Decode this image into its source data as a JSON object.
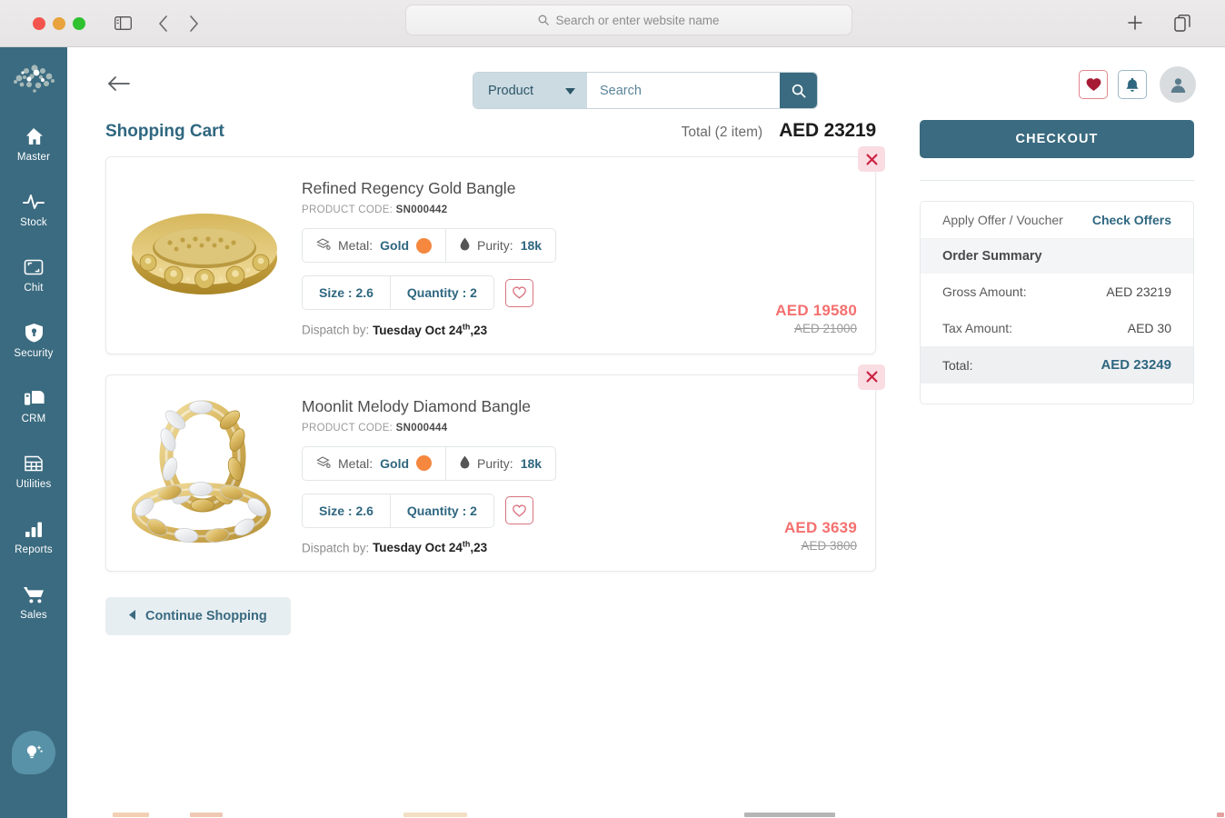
{
  "browser": {
    "url_placeholder": "Search or enter website name",
    "icons": {
      "sidebar_toggle": "sidebar-toggle-icon",
      "back": "back-chevron-icon",
      "forward": "forward-chevron-icon",
      "new_tab": "plus-icon",
      "tab_overview": "tab-overview-icon",
      "search": "search-icon"
    }
  },
  "sidebar": {
    "logo": "bubble-cloud-logo",
    "items": [
      {
        "label": "Master",
        "icon": "home-icon"
      },
      {
        "label": "Stock",
        "icon": "pulse-icon"
      },
      {
        "label": "Chit",
        "icon": "chit-frame-icon"
      },
      {
        "label": "Security",
        "icon": "shield-icon"
      },
      {
        "label": "CRM",
        "icon": "crm-cards-icon"
      },
      {
        "label": "Utilities",
        "icon": "table-grid-icon"
      },
      {
        "label": "Reports",
        "icon": "bar-chart-icon"
      },
      {
        "label": "Sales",
        "icon": "cart-icon"
      }
    ],
    "fab": "lightbulb-tips-icon"
  },
  "header": {
    "back_icon": "back-arrow-icon",
    "search_category": "Product",
    "search_placeholder": "Search",
    "search_value": "",
    "search_button_icon": "search-icon",
    "actions": [
      {
        "name": "wishlist",
        "icon": "heart-icon"
      },
      {
        "name": "notifications",
        "icon": "bell-icon"
      },
      {
        "name": "account",
        "icon": "user-icon"
      }
    ]
  },
  "cart": {
    "title": "Shopping Cart",
    "total_label": "Total (2 item)",
    "total_amount": "AED 23219",
    "remove_icon": "close-icon",
    "continue_label": "Continue Shopping",
    "continue_icon": "caret-left-icon",
    "items": [
      {
        "name": "Refined Regency Gold Bangle",
        "code_label": "PRODUCT CODE:",
        "code": "SN000442",
        "metal_label": "Metal:",
        "metal": "Gold",
        "metal_icon": "metal-stack-icon",
        "metal_color": "#f5873f",
        "purity_label": "Purity:",
        "purity": "18k",
        "purity_icon": "droplet-icon",
        "size": "Size : 2.6",
        "quantity": "Quantity : 2",
        "wish_icon": "heart-outline-icon",
        "dispatch_label": "Dispatch by:",
        "dispatch_day": "Tuesday Oct 24",
        "dispatch_sup": "th",
        "dispatch_year": ",23",
        "price": "AED 19580",
        "price_old": "AED 21000",
        "image": "gold-bangle-image"
      },
      {
        "name": "Moonlit Melody Diamond Bangle",
        "code_label": "PRODUCT CODE:",
        "code": "SN000444",
        "metal_label": "Metal:",
        "metal": "Gold",
        "metal_icon": "metal-stack-icon",
        "metal_color": "#f5873f",
        "purity_label": "Purity:",
        "purity": "18k",
        "purity_icon": "droplet-icon",
        "size": "Size : 2.6",
        "quantity": "Quantity : 2",
        "wish_icon": "heart-outline-icon",
        "dispatch_label": "Dispatch by:",
        "dispatch_day": "Tuesday Oct 24",
        "dispatch_sup": "th",
        "dispatch_year": ",23",
        "price": "AED 3639",
        "price_old": "AED 3800",
        "image": "diamond-bangle-image"
      }
    ]
  },
  "order": {
    "checkout_label": "CHECKOUT",
    "voucher_label": "Apply Offer / Voucher",
    "check_offers_label": "Check Offers",
    "summary_title": "Order Summary",
    "rows": [
      {
        "key": "Gross Amount:",
        "value": "AED 23219"
      },
      {
        "key": "Tax Amount:",
        "value": "AED 30"
      }
    ],
    "total_key": "Total:",
    "total_value": "AED 23249"
  },
  "colors": {
    "brand_teal": "#3b6b80",
    "accent_red": "#f4706f",
    "gold": "#f5873f",
    "panel_grey": "#eef0f2"
  }
}
